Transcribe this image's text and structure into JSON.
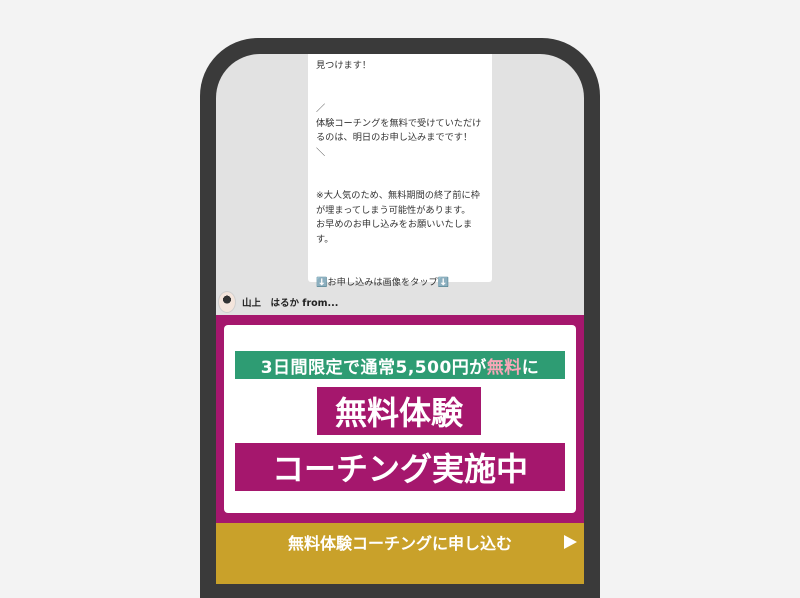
{
  "message": {
    "lines": [
      "理想の未来を叶えるために必要な要素を見つけます！",
      "",
      "",
      "／",
      "体験コーチングを無料で受けていただけるのは、明日のお申し込みまでです！",
      "＼",
      "",
      "",
      "※大人気のため、無料期間の終了前に枠が埋まってしまう可能性があります。",
      "お早めのお申し込みをお願いいたします。",
      "",
      "",
      "⬇️お申し込みは画像をタップ⬇️"
    ]
  },
  "sender": {
    "name": "山上　はるか from..."
  },
  "banner": {
    "promo_prefix": "3日間限定で通常5,500円が",
    "promo_highlight": "無料",
    "promo_suffix": "に",
    "title_line1": "無料体験",
    "title_line2": "コーチング実施中",
    "cta_label": "無料体験コーチングに申し込む"
  },
  "colors": {
    "accent": "#a5176d",
    "green": "#2e9c73",
    "cta": "#c9a12a",
    "highlight": "#f7a7b8"
  }
}
